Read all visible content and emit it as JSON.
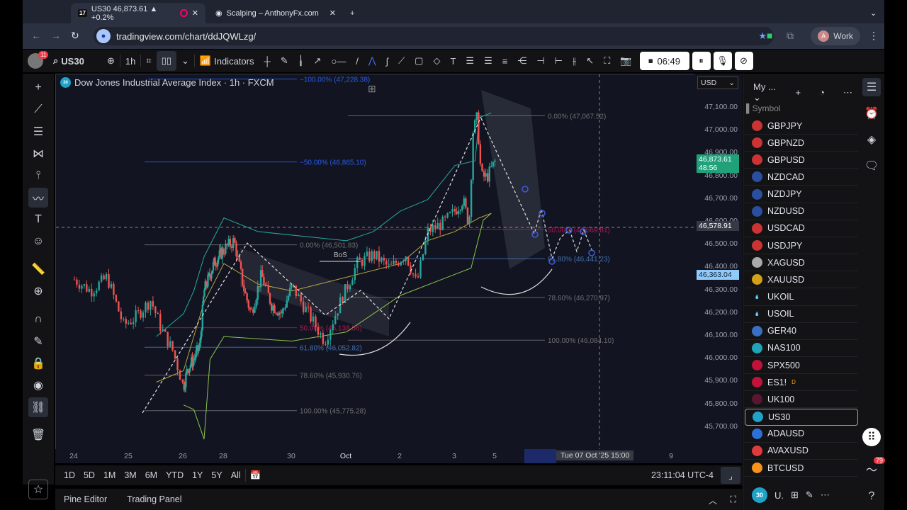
{
  "browser": {
    "tabs": [
      {
        "label": "US30 46,873.61 ▲ +0.2%",
        "active": true
      },
      {
        "label": "Scalping – AnthonyFx.com",
        "active": false
      }
    ],
    "url": "tradingview.com/chart/ddJQWLzg/",
    "profile_label": "Work",
    "profile_initial": "A"
  },
  "toolbar": {
    "symbol": "US30",
    "interval": "1h",
    "indicators_label": "Indicators",
    "recording_time": "06:49",
    "notification_count": "11"
  },
  "chart": {
    "title": "Dow Jones Industrial Average Index · 1h · FXCM",
    "symbol_badge": "30",
    "currency": "USD",
    "price_ticks": [
      "47,100.00",
      "47,000.00",
      "46,900.00",
      "46,800.00",
      "46,700.00",
      "46,600.00",
      "46,500.00",
      "46,400.00",
      "46,300.00",
      "46,200.00",
      "46,100.00",
      "46,000.00",
      "45,900.00",
      "45,800.00",
      "45,700.00"
    ],
    "current_price": "46,873.61",
    "countdown": "48:56",
    "crosshair_price": "46,578.91",
    "marker_price": "46,363.04",
    "time_ticks": [
      "24",
      "25",
      "26",
      "28",
      "30",
      "Oct",
      "2",
      "3",
      "5",
      "9"
    ],
    "crosshair_time": "Tue 07 Oct '25  15:00",
    "fib_labels": {
      "a": "−100.00% (47,228.38)",
      "b": "−50.00% (46,865.10)",
      "c": "0.00% (46,501.83)",
      "d": "50.00% (46,138.56)",
      "e": "61.80% (46,052.82)",
      "f": "78.60% (45,930.76)",
      "g": "100.00% (45,775.28)",
      "h": "0.00% (47,067.52)",
      "i": "50.00% (46,569.81)",
      "j": "61.80% (46,441.23)",
      "k": "78.60% (46,270.97)",
      "l": "100.00% (46,084.10)"
    },
    "bos_label": "BoS",
    "colors": {
      "up": "#26a69a",
      "down": "#ef5350",
      "bg": "#121521"
    },
    "price_path": [
      [
        24,
        46350
      ],
      [
        24.3,
        46300
      ],
      [
        24.6,
        46360
      ],
      [
        24.9,
        46150
      ],
      [
        25.1,
        46180
      ],
      [
        25.4,
        46260
      ],
      [
        25.6,
        46130
      ],
      [
        25.8,
        46040
      ],
      [
        26,
        45880
      ],
      [
        26.2,
        45960
      ],
      [
        26.5,
        46000
      ],
      [
        26.8,
        46060
      ],
      [
        27,
        46300
      ],
      [
        27.5,
        46420
      ],
      [
        28.3,
        46520
      ],
      [
        28.6,
        46300
      ],
      [
        28.8,
        46200
      ],
      [
        29.1,
        46370
      ],
      [
        29.4,
        46240
      ],
      [
        29.7,
        46200
      ],
      [
        30,
        46320
      ],
      [
        30.4,
        46160
      ],
      [
        30.6,
        46080
      ],
      [
        30.9,
        46260
      ],
      [
        31.2,
        46420
      ],
      [
        31.5,
        46460
      ],
      [
        31.8,
        46400
      ],
      [
        32.1,
        46460
      ],
      [
        32.3,
        46330
      ],
      [
        32.5,
        46560
      ],
      [
        32.8,
        46600
      ],
      [
        33.2,
        46700
      ],
      [
        33.35,
        46590
      ],
      [
        33.45,
        47000
      ],
      [
        33.55,
        47060
      ],
      [
        33.65,
        46800
      ],
      [
        33.8,
        46800
      ],
      [
        34,
        46870
      ]
    ]
  },
  "ranges": [
    "1D",
    "5D",
    "1M",
    "3M",
    "6M",
    "YTD",
    "1Y",
    "5Y",
    "All"
  ],
  "clock": "23:11:04 UTC-4",
  "bottom_tabs": [
    "Pine Editor",
    "Trading Panel"
  ],
  "watchlist": {
    "title": "My ...",
    "column": "Symbol",
    "items": [
      {
        "s": "GBPJPY",
        "c": "#c33"
      },
      {
        "s": "GBPNZD",
        "c": "#c33"
      },
      {
        "s": "GBPUSD",
        "c": "#c33"
      },
      {
        "s": "NZDCAD",
        "c": "#2a4fa0"
      },
      {
        "s": "NZDJPY",
        "c": "#2a4fa0"
      },
      {
        "s": "NZDUSD",
        "c": "#2a4fa0"
      },
      {
        "s": "USDCAD",
        "c": "#c33"
      },
      {
        "s": "USDJPY",
        "c": "#c33"
      },
      {
        "s": "XAGUSD",
        "c": "#aaa"
      },
      {
        "s": "XAUUSD",
        "c": "#d4a017"
      },
      {
        "s": "UKOIL",
        "c": "#131316"
      },
      {
        "s": "USOIL",
        "c": "#131316"
      },
      {
        "s": "GER40",
        "c": "#3b6fc4"
      },
      {
        "s": "NAS100",
        "c": "#1fa3b8"
      },
      {
        "s": "SPX500",
        "c": "#c2123b"
      },
      {
        "s": "ES1!",
        "c": "#c2123b",
        "badge": "D"
      },
      {
        "s": "UK100",
        "c": "#5a1530"
      },
      {
        "s": "US30",
        "c": "#1fa3c8",
        "selected": true
      },
      {
        "s": "ADAUSD",
        "c": "#2f6fd8"
      },
      {
        "s": "AVAXUSD",
        "c": "#e0393e"
      },
      {
        "s": "BTCUSD",
        "c": "#f7931a"
      }
    ],
    "footer_symbol": "U.",
    "footer_badge": "30"
  },
  "right_badge": "79"
}
